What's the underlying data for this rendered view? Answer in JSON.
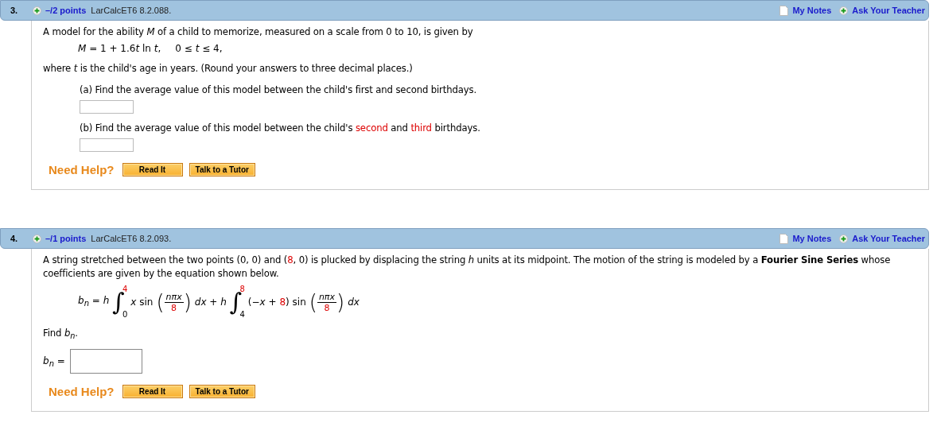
{
  "questions": [
    {
      "number": "3.",
      "points": "–/2 points",
      "code": "LarCalcET6 8.2.088.",
      "notes": "My Notes",
      "ask": "Ask Your Teacher",
      "blocks": [
        {
          "kind": "paragraph",
          "segments": [
            {
              "text": "A model for the ability *M* of a child to memorize, measured on a scale from 0 to 10, is given by",
              "red": false
            }
          ]
        },
        {
          "kind": "formula",
          "tokens": [
            {
              "kind": "text",
              "segments": [
                {
                  "text": "*M* = 1 + 1.6",
                  "red": false
                },
                {
                  "text": "*t* ln *t*,",
                  "red": false
                }
              ]
            },
            {
              "kind": "text",
              "segments": [
                {
                  "text": "0 ≤ *t* ≤ 4,",
                  "red": false
                }
              ]
            }
          ]
        },
        {
          "kind": "paragraph",
          "segments": [
            {
              "text": "where *t* is the child's age in years. (Round your answers to three decimal places.)",
              "red": false
            }
          ]
        },
        {
          "kind": "subparagraph",
          "segments": [
            {
              "text": "(a) Find the average value of this model between the child's first and second birthdays.",
              "red": false
            }
          ]
        },
        {
          "kind": "small_field"
        },
        {
          "kind": "subparagraph",
          "segments": [
            {
              "text": "(b) Find the average value of this model between the child's ",
              "red": false
            },
            {
              "text": "second",
              "red": true
            },
            {
              "text": " and ",
              "red": false
            },
            {
              "text": "third",
              "red": true
            },
            {
              "text": " birthdays.",
              "red": false
            }
          ]
        },
        {
          "kind": "small_field"
        },
        {
          "kind": "help",
          "label": "Need Help?",
          "buttons": [
            "Read It",
            "Talk to a Tutor"
          ]
        }
      ]
    },
    {
      "number": "4.",
      "points": "–/1 points",
      "code": "LarCalcET6 8.2.093.",
      "notes": "My Notes",
      "ask": "Ask Your Teacher",
      "blocks": [
        {
          "kind": "paragraph",
          "segments": [
            {
              "text": "A string stretched between the two points (0, 0) and (",
              "red": false
            },
            {
              "text": "8",
              "red": true
            },
            {
              "text": ", 0) is plucked by displacing the string *h* units at its midpoint. The motion of the string is modeled by a **Fourier Sine Series** whose coefficients are given by the equation shown below.",
              "red": false
            }
          ]
        },
        {
          "kind": "formula",
          "tokens": [
            {
              "kind": "text",
              "segments": [
                {
                  "text": "*b*$_{n}$ = *h*",
                  "red": false
                }
              ]
            },
            {
              "kind": "integral",
              "symbol": "∫",
              "lower": "0",
              "upper": "4",
              "upper_red": true
            },
            {
              "kind": "text",
              "segments": [
                {
                  "text": "*x* sin",
                  "red": false
                }
              ]
            },
            {
              "kind": "fraction",
              "open": "(",
              "close": ")",
              "numerator": "*nπx*",
              "denominator": "8",
              "denominator_red": true
            },
            {
              "kind": "text",
              "segments": [
                {
                  "text": "*dx* + *h*",
                  "red": false
                }
              ]
            },
            {
              "kind": "integral",
              "symbol": "∫",
              "lower": "4",
              "upper": "8",
              "upper_red": true
            },
            {
              "kind": "text",
              "segments": [
                {
                  "text": "(−*x* + ",
                  "red": false
                },
                {
                  "text": "8",
                  "red": true
                },
                {
                  "text": ") sin",
                  "red": false
                }
              ]
            },
            {
              "kind": "fraction",
              "open": "(",
              "close": ")",
              "numerator": "*nπx*",
              "denominator": "8",
              "denominator_red": true
            },
            {
              "kind": "text",
              "segments": [
                {
                  "text": "*dx*",
                  "red": false
                }
              ]
            }
          ]
        },
        {
          "kind": "paragraph",
          "segments": [
            {
              "text": "Find *b*$_{n}$.",
              "red": false
            }
          ]
        },
        {
          "kind": "labeled_field",
          "label": "*b*$_{n}$ ="
        },
        {
          "kind": "help",
          "label": "Need Help?",
          "buttons": [
            "Read It",
            "Talk to a Tutor"
          ]
        }
      ]
    }
  ]
}
